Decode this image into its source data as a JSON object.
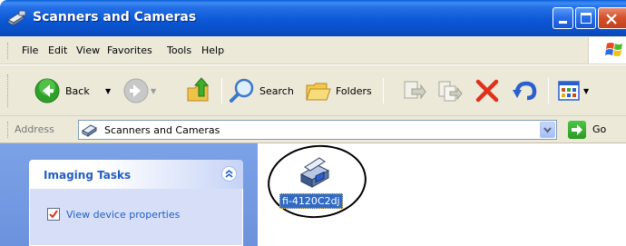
{
  "window": {
    "title": "Scanners and Cameras"
  },
  "menu": {
    "items": [
      {
        "label": "File"
      },
      {
        "label": "Edit"
      },
      {
        "label": "View"
      },
      {
        "label": "Favorites"
      },
      {
        "label": "Tools"
      },
      {
        "label": "Help"
      }
    ]
  },
  "toolbar": {
    "back_label": "Back",
    "search_label": "Search",
    "folders_label": "Folders"
  },
  "address": {
    "label": "Address",
    "value": "Scanners and Cameras",
    "go_label": "Go"
  },
  "tasks": {
    "title": "Imaging Tasks",
    "items": [
      {
        "label": "View device properties"
      }
    ]
  },
  "devices": [
    {
      "label": "fi-4120C2dj"
    }
  ],
  "colors": {
    "titlebar": "#0a58d6",
    "taskpane": "#7ba2e7",
    "link": "#215dc6",
    "selection": "#316ac5"
  }
}
